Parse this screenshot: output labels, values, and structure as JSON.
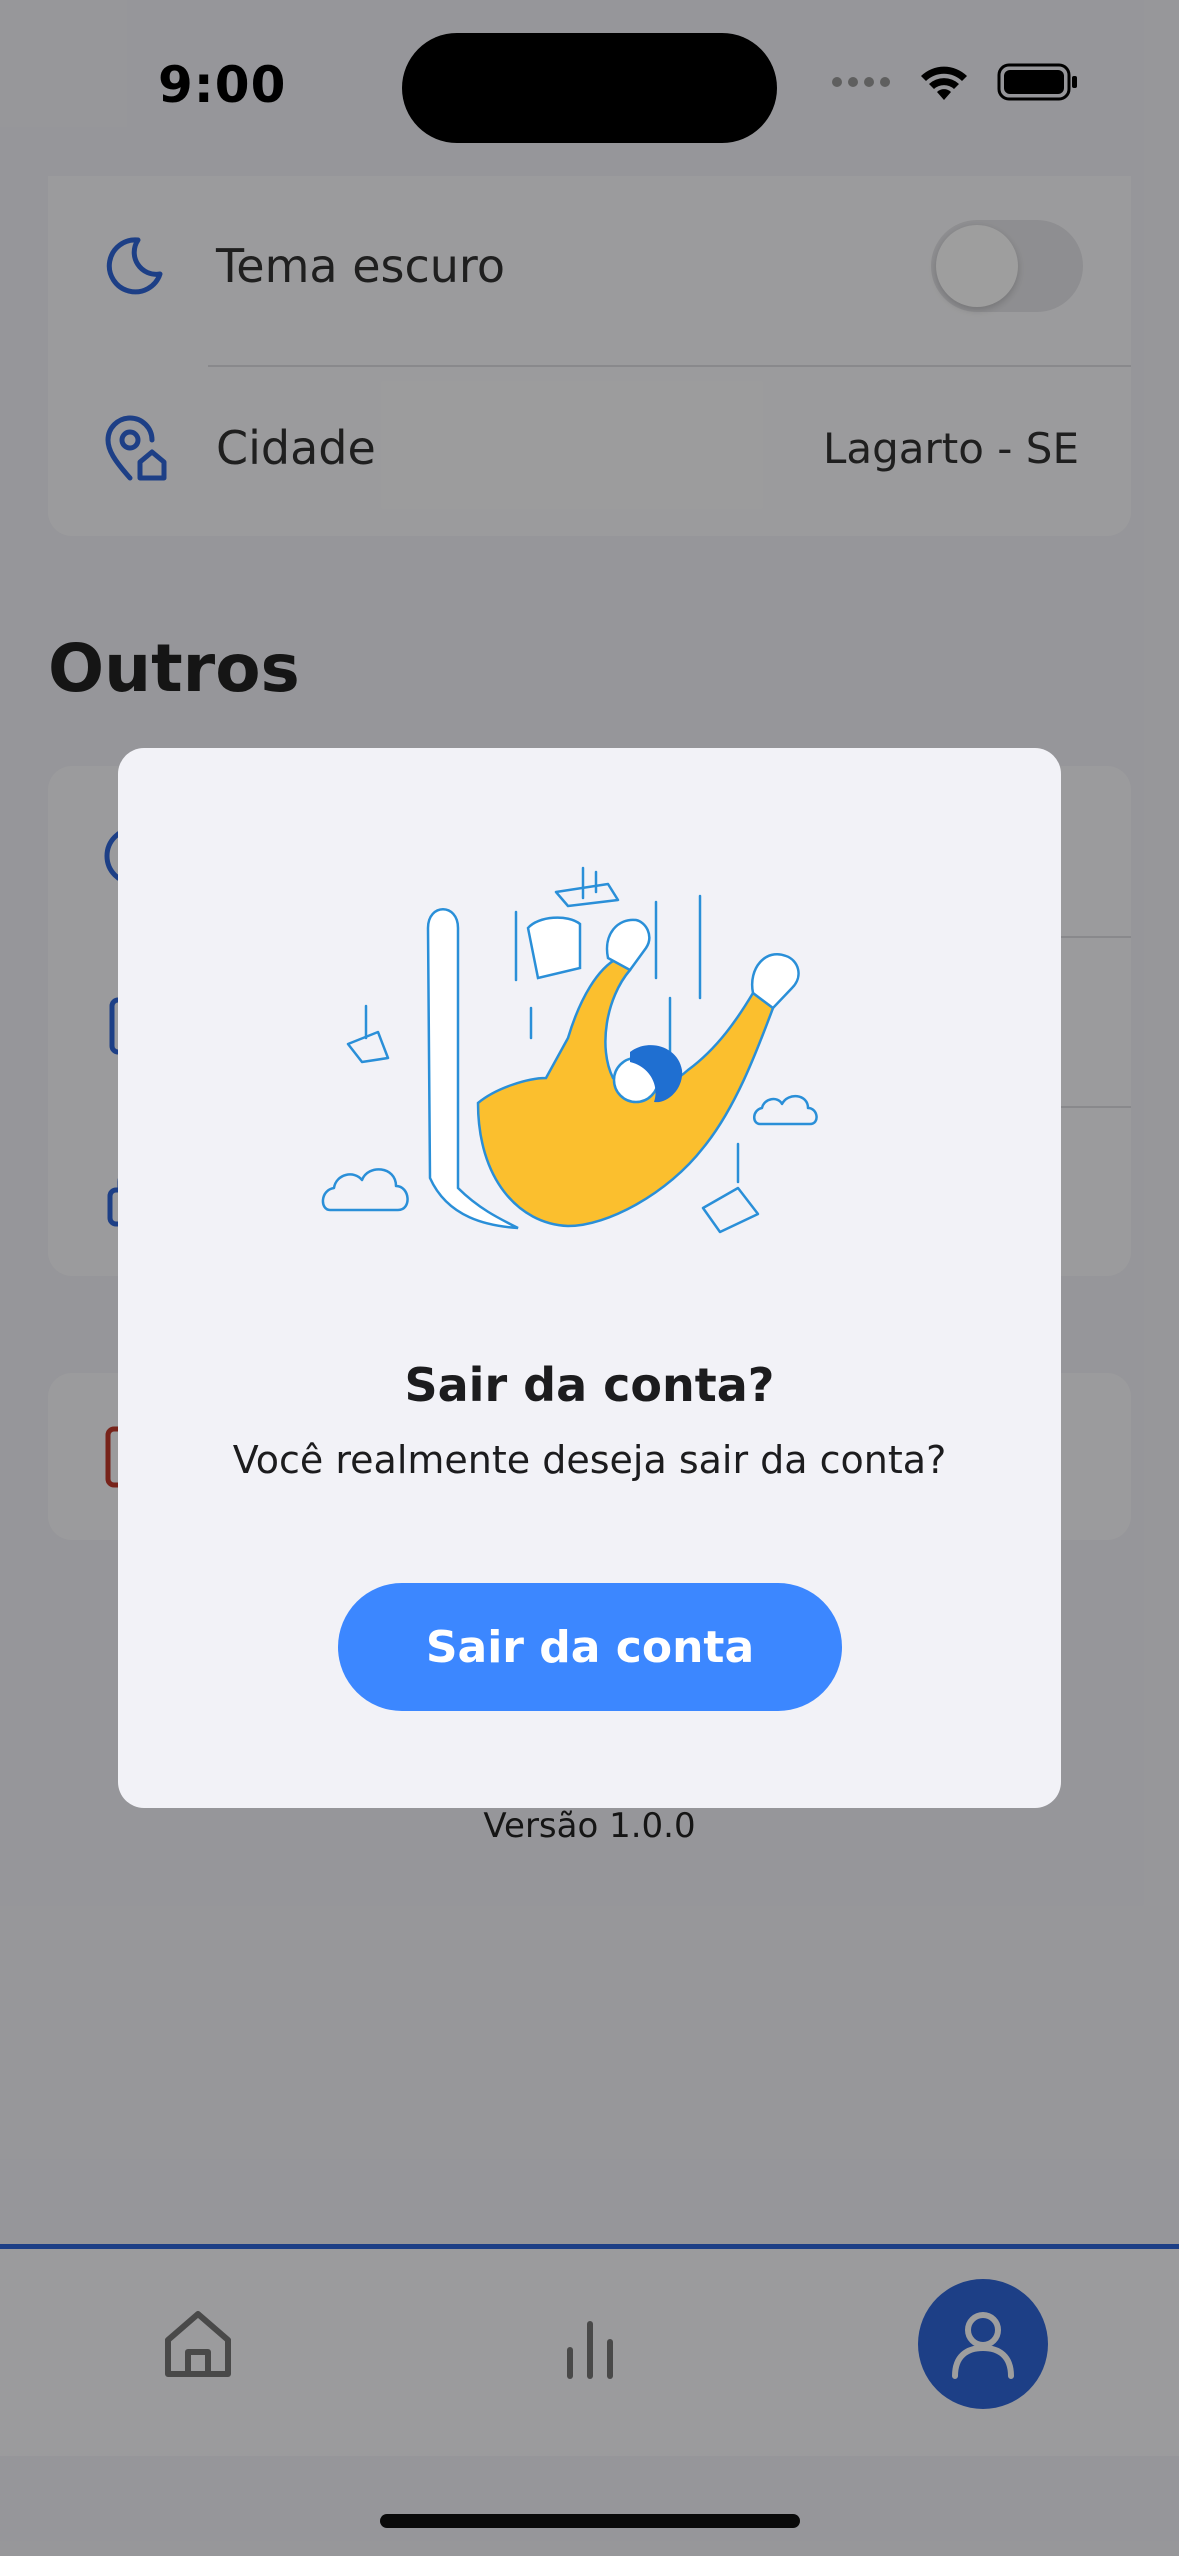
{
  "status_bar": {
    "time": "9:00"
  },
  "settings": {
    "dark_theme_label": "Tema escuro",
    "dark_theme_enabled": false,
    "city_label": "Cidade",
    "city_value": "Lagarto - SE"
  },
  "others": {
    "title": "Outros"
  },
  "footer": {
    "version": "Versão 1.0.0"
  },
  "modal": {
    "title": "Sair da conta?",
    "message": "Você realmente deseja sair da conta?",
    "confirm_label": "Sair da conta"
  },
  "tabs": [
    "home-icon",
    "chart-icon",
    "profile-icon"
  ],
  "colors": {
    "accent": "#2f66d8",
    "button": "#3c87ff",
    "danger": "#c0392b",
    "illustration_yellow": "#fbbf2e",
    "illustration_blue": "#2a8fd8"
  }
}
